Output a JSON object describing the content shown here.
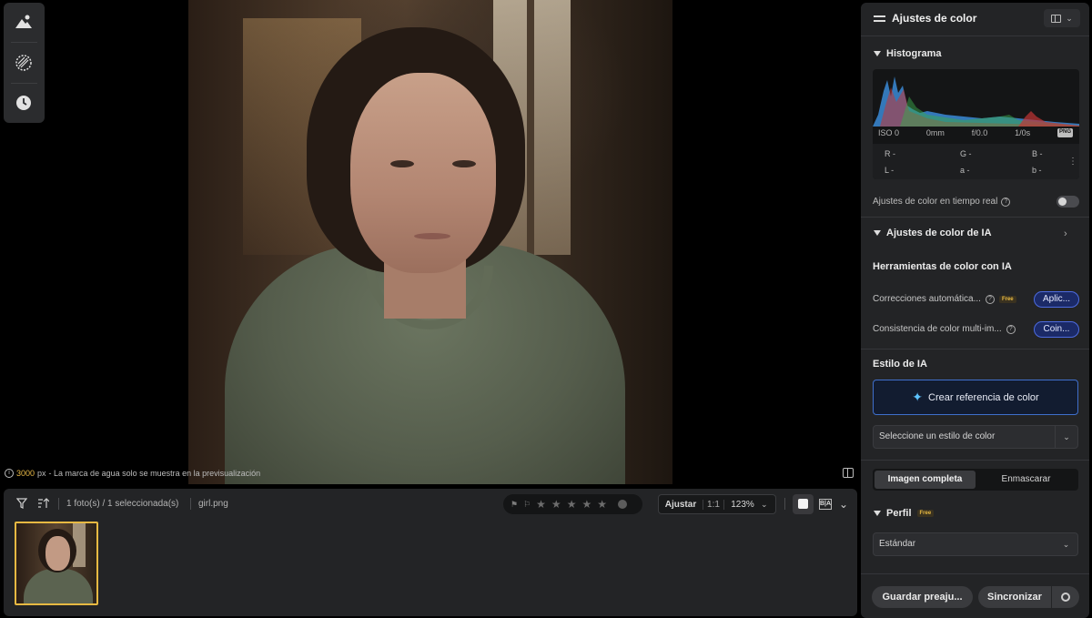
{
  "canvas": {
    "note_px": "3000",
    "note_unit": "px",
    "note_text": " - La marca de agua solo se muestra en la previsualización"
  },
  "filmstrip": {
    "count": "1 foto(s) / 1 seleccionada(s)",
    "filename": "girl.png",
    "zoom": {
      "fit": "Ajustar",
      "one_to_one": "1:1",
      "percent": "123%"
    },
    "ba_label": "B|A"
  },
  "panel": {
    "title": "Ajustes de color",
    "histogram": {
      "title": "Histograma",
      "iso": "ISO 0",
      "focal": "0mm",
      "aperture": "f/0.0",
      "shutter": "1/0s",
      "format": "PNG",
      "r": "R -",
      "g": "G -",
      "b": "B -",
      "l": "L -",
      "a": "a -",
      "bb": "b -"
    },
    "realtime": "Ajustes de color en tiempo real",
    "ai_section": "Ajustes de color de IA",
    "ai_tools": "Herramientas de color con IA",
    "auto_correct": "Correcciones automática...",
    "free": "Free",
    "apply": "Aplic...",
    "consistency": "Consistencia de color multi-im...",
    "coin": "Coin...",
    "ai_style": "Estilo de IA",
    "create_ref": "Crear referencia de color",
    "style_select": "Seleccione un estilo de color",
    "seg_full": "Imagen completa",
    "seg_mask": "Enmascarar",
    "profile": "Perfil",
    "profile_value": "Estándar",
    "save_preset": "Guardar preaju...",
    "sync": "Sincronizar"
  },
  "colors": {
    "accent": "#e7b942",
    "ai_blue": "#4d6be0"
  }
}
